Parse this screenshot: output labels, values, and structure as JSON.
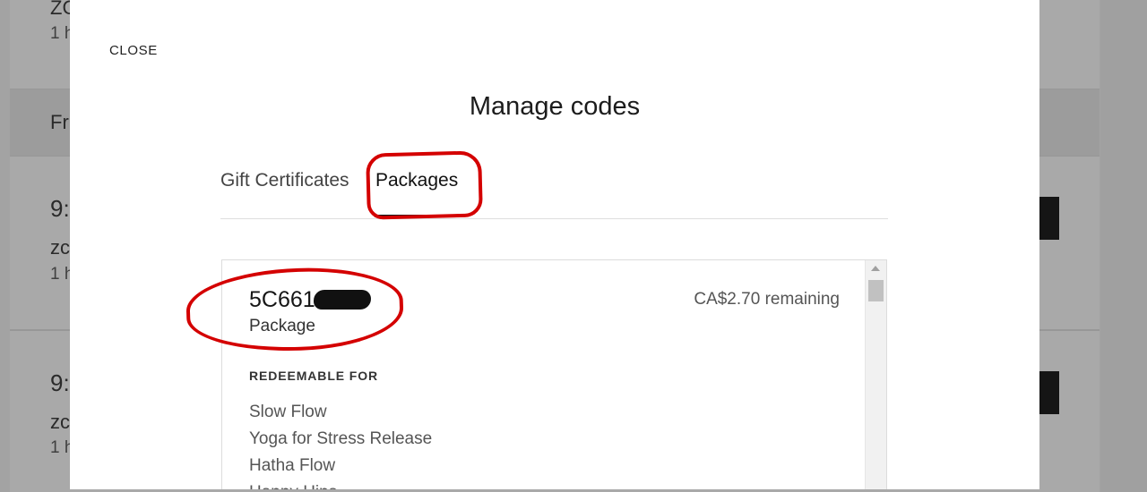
{
  "background": {
    "texts": [
      "ZC",
      "1 h",
      "Fri",
      "9:",
      "zc",
      "1 h",
      "9:",
      "zc",
      "1 h"
    ]
  },
  "modal": {
    "close_label": "CLOSE",
    "title": "Manage codes",
    "tabs": [
      {
        "label": "Gift Certificates",
        "active": false
      },
      {
        "label": "Packages",
        "active": true
      }
    ],
    "package": {
      "code_visible": "5C661",
      "type": "Package",
      "remaining": "CA$2.70 remaining",
      "redeemable_heading": "REDEEMABLE FOR",
      "redeemable_items": [
        "Slow Flow",
        "Yoga for Stress Release",
        "Hatha Flow",
        "Happy Hips"
      ]
    }
  },
  "colors": {
    "annotation": "#d40000",
    "overlay": "#a3a3a3",
    "modal_bg": "#ffffff"
  }
}
